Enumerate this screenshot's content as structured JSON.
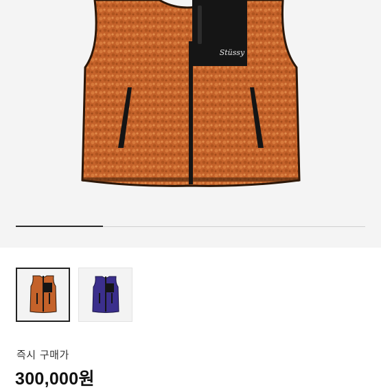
{
  "product": {
    "brand_logo": "Stüssy",
    "image_name": "orange-sherpa-vest",
    "colors": {
      "fleece": "#c4622a",
      "trim": "#151515",
      "alt_fleece": "#3b2f8c"
    }
  },
  "gallery": {
    "progress": 0.25,
    "thumbnails": [
      {
        "name": "orange-vest",
        "selected": true
      },
      {
        "name": "purple-vest",
        "selected": false
      }
    ]
  },
  "price": {
    "label": "즉시 구매가",
    "value": "300,000원"
  }
}
